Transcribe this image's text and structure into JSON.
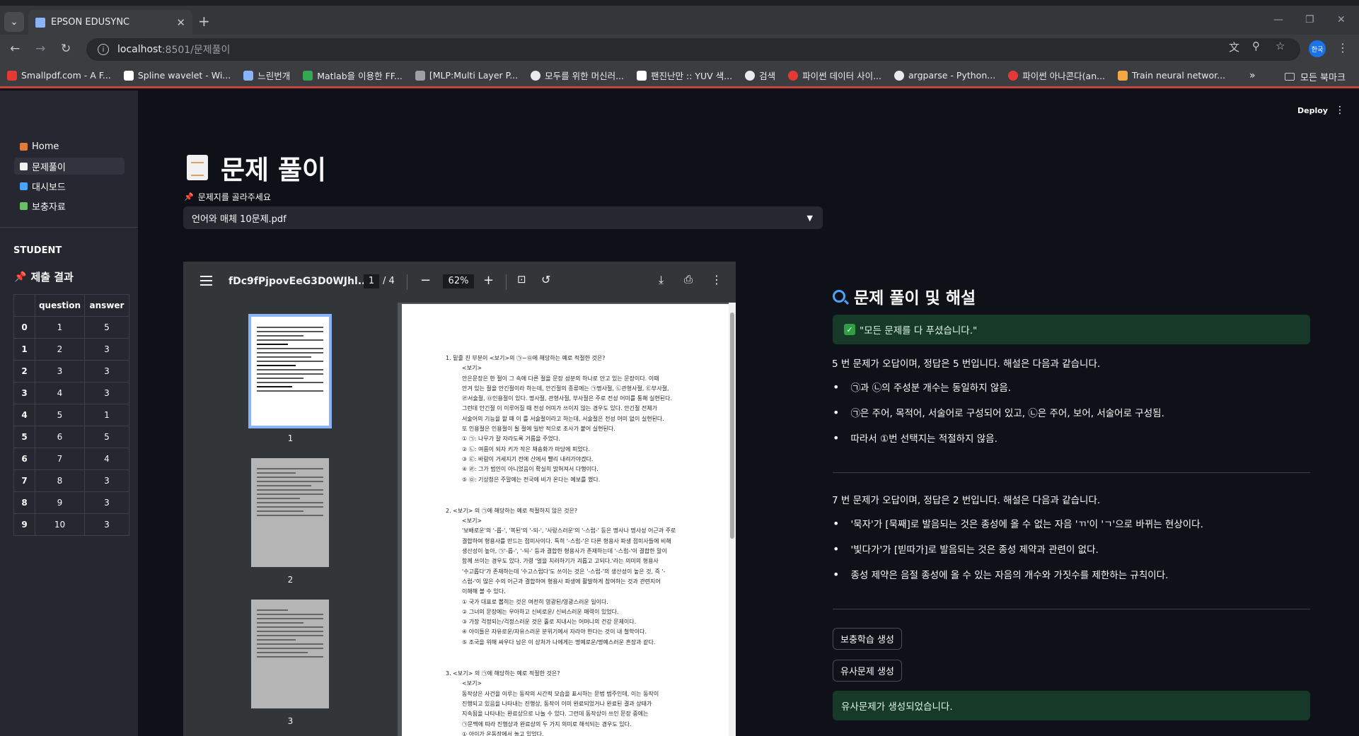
{
  "browser": {
    "tab_title": "EPSON EDUSYNC",
    "url_host": "localhost",
    "url_rest": ":8501/문제풀이",
    "profile_label": "한국",
    "bookmarks": [
      {
        "label": "Smallpdf.com - A F...",
        "color": "#e53935"
      },
      {
        "label": "Spline wavelet - Wi...",
        "color": "#ffffff"
      },
      {
        "label": "느린번개",
        "color": "#8ab4f8"
      },
      {
        "label": "Matlab을 이용한 FF...",
        "color": "#34a853"
      },
      {
        "label": "[MLP:Multi Layer P...",
        "color": "#9aa0a6"
      },
      {
        "label": "모두를 위한 머신러...",
        "color": "#e8eaed"
      },
      {
        "label": "팬진난만 :: YUV 색...",
        "color": "#ffffff"
      },
      {
        "label": "검색",
        "color": "#e8eaed"
      },
      {
        "label": "파이썬 데이터 사이...",
        "color": "#e53935"
      },
      {
        "label": "argparse - Python...",
        "color": "#e8eaed"
      },
      {
        "label": "파이썬 아나콘다(an...",
        "color": "#e53935"
      },
      {
        "label": "Train neural networ...",
        "color": "#f4a742"
      }
    ],
    "bookmarks_all": "모든 북마크"
  },
  "sidebar": {
    "nav": [
      {
        "label": "Home",
        "icon": "house-icon",
        "color": "#e07b39"
      },
      {
        "label": "문제풀이",
        "icon": "page-icon",
        "color": "#f1f1f1"
      },
      {
        "label": "대시보드",
        "icon": "chart-icon",
        "color": "#4aa3ff"
      },
      {
        "label": "보충자료",
        "icon": "books-icon",
        "color": "#6abf69"
      }
    ],
    "student_label": "STUDENT",
    "result_title": "제출 결과",
    "table": {
      "headers": [
        "",
        "question",
        "answer"
      ],
      "rows": [
        [
          "0",
          "1",
          "5"
        ],
        [
          "1",
          "2",
          "3"
        ],
        [
          "2",
          "3",
          "3"
        ],
        [
          "3",
          "4",
          "3"
        ],
        [
          "4",
          "5",
          "1"
        ],
        [
          "5",
          "6",
          "5"
        ],
        [
          "6",
          "7",
          "4"
        ],
        [
          "7",
          "8",
          "3"
        ],
        [
          "8",
          "9",
          "3"
        ],
        [
          "9",
          "10",
          "3"
        ]
      ]
    }
  },
  "header": {
    "deploy": "Deploy"
  },
  "main": {
    "title": "문제 풀이",
    "select_label": "문제지를 골라주세요",
    "select_value": "언어와 매체 10문제.pdf"
  },
  "pdf": {
    "file_name": "fDc9fPjpovEeG3D0WJhl...",
    "page_current": "1",
    "page_total": "/ 4",
    "zoom": "62%",
    "thumb_labels": [
      "1",
      "2",
      "3"
    ],
    "content": [
      {
        "head": "1.  밑줄 친 부분이 <보기>의 ㉠~㉤에 해당하는 예로 적절한 것은?",
        "lines": [
          "<보기>",
          "안은문장은 한 절이 그 속에 다른 절을 문장 성분의 하나로 안고 있는 문장이다. 이때",
          "안겨 있는 절을 안긴절이라 하는데, 안긴절의 종류에는 ㉠명사절, ㉡관형사절, ㉢부사절,",
          "㉣서술절, ㉤인용절이 있다. 명사절, 관형사절, 부사절은 주로 전성 어미를 통해 실현된다.",
          "그런데 안긴절 이 이루어질 때 전성 어미가 쓰이지 않는 경우도 있다. 안긴절 전체가",
          "서술어의 기능을 할 때 이 를 서술절이라고 하는데, 서술절은 전성 어미 없이 실현된다.",
          "또 인용절은 인용절이 될 절에 일반 적으로 조사가 붙어 실현된다.",
          "① ㉠: 나무가 잘 자라도록 거름을 주었다.",
          "② ㉡: 여름이 되자 키가 작은 채송화가 마당에 피었다.",
          "③ ㉢: 바람이 거세지기 전에 산에서 빨리 내려가야겠다.",
          "④ ㉣: 그가 범인이 아니었음이 확실히 밝혀져서 다행이다.",
          "⑤ ㉤: 기상청은 주말에는 전국에 비가 온다는 예보를 했다."
        ]
      },
      {
        "head": "2.  <보기> 의 ㉠에 해당하는 예로 적절하지 않은 것은?",
        "lines": [
          "<보기>",
          "'보배로운'의 '-롭-', '복된'의 '-되-', '사랑스러운'의 '-스럽-' 등은 명사나 명사성 어근과 주로",
          "결합하여 형용사를 만드는 접미사이다. 특히 '-스럽-'은 다른 형용사 파생 접미사들에 비해",
          "생산성이 높아, ㉠'-롭-', '-되-' 등과 결합한 형용사가 존재하는데 '-스럽-'이 결합한 말이",
          "함께 쓰이는 경우도 있다. 가령 '얼을 치러하기가 괴롭고 고되다.'라는 의미의 형용사",
          "'수고롭다'가 존재하는데 '수고스럽다'도 쓰이는 것은 '-스럽-'의 생산성이 높은 것, 즉 '-",
          "스럽-'이 많은 수의 어근과 결합하여 형용사 파생에 활발하게 참여하는 것과 관련지어",
          "이해해 볼 수 있다.",
          "① 국가 대표로 뽑히는 것은 여전히 영광된/영광스러운 일이다.",
          "② 그녀의 문장에는 우아하고 신비로운/ 신비스러운 매력이 있었다.",
          "③ 가장 걱정되는/걱정스러운 것은 홀로 지내시는 어머니의 건강 문제이다.",
          "④ 아이들은 자유로운/자유스러운 분위기에서 자라야 한다는 것이 내 철학이다.",
          "⑤ 조국을 위해 싸우다 남은 이 상처가 나에게는 명예로운/명예스러운 흔장과 같다."
        ]
      },
      {
        "head": "3.  <보기> 의 ㉠에 해당하는 예로 적절한 것은?",
        "lines": [
          "<보기>",
          "동작상은 사건을 이루는 동작의 시간적 모습을 표시하는 문법 범주인데, 이는 동작이",
          "진행되고 있음을 나타내는 진행상, 동작이 이미 완료되었거나 완료된 결과 상태가",
          "지속됨을 나타내는 완료상으로 나눌 수 있다. 그런데 동작상이 쓰인 문장 중에는",
          "㉠문맥에 따라 진행상과 완료상의 두 가지 의미로 해석되는 경우도 있다.",
          "① 아이가 운동장에서 놀고 있었다."
        ]
      }
    ]
  },
  "solution": {
    "title": "문제 풀이 및 해설",
    "done_msg": "\"모든 문제를 다 푸셨습니다.\"",
    "block1": {
      "intro": "5 번 문제가 오답이며, 정답은 5 번입니다. 해설은 다음과 같습니다.",
      "bullets": [
        "㉠과 ㉡의 주성분 개수는 동일하지 않음.",
        "㉠은 주어, 목적어, 서술어로 구성되어 있고, ㉡은 주어, 보어, 서술어로 구성됨.",
        "따라서 ①번 선택지는 적절하지 않음."
      ]
    },
    "block2": {
      "intro": "7 번 문제가 오답이며, 정답은 2 번입니다. 해설은 다음과 같습니다.",
      "bullets": [
        "'묵자'가 [묵째]로 발음되는 것은 종성에 올 수 없는 자음 'ㄲ'이 'ㄱ'으로 바뀌는 현상이다.",
        "'빛다가'가 [빋따가]로 발음되는 것은 종성 제약과 관련이 없다.",
        "종성 제약은 음절 종성에 올 수 있는 자음의 개수와 가짓수를 제한하는 규칙이다."
      ]
    },
    "btn_supplement": "보충학습 생성",
    "btn_similar": "유사문제 생성",
    "similar_msg": "유사문제가 생성되었습니다."
  }
}
